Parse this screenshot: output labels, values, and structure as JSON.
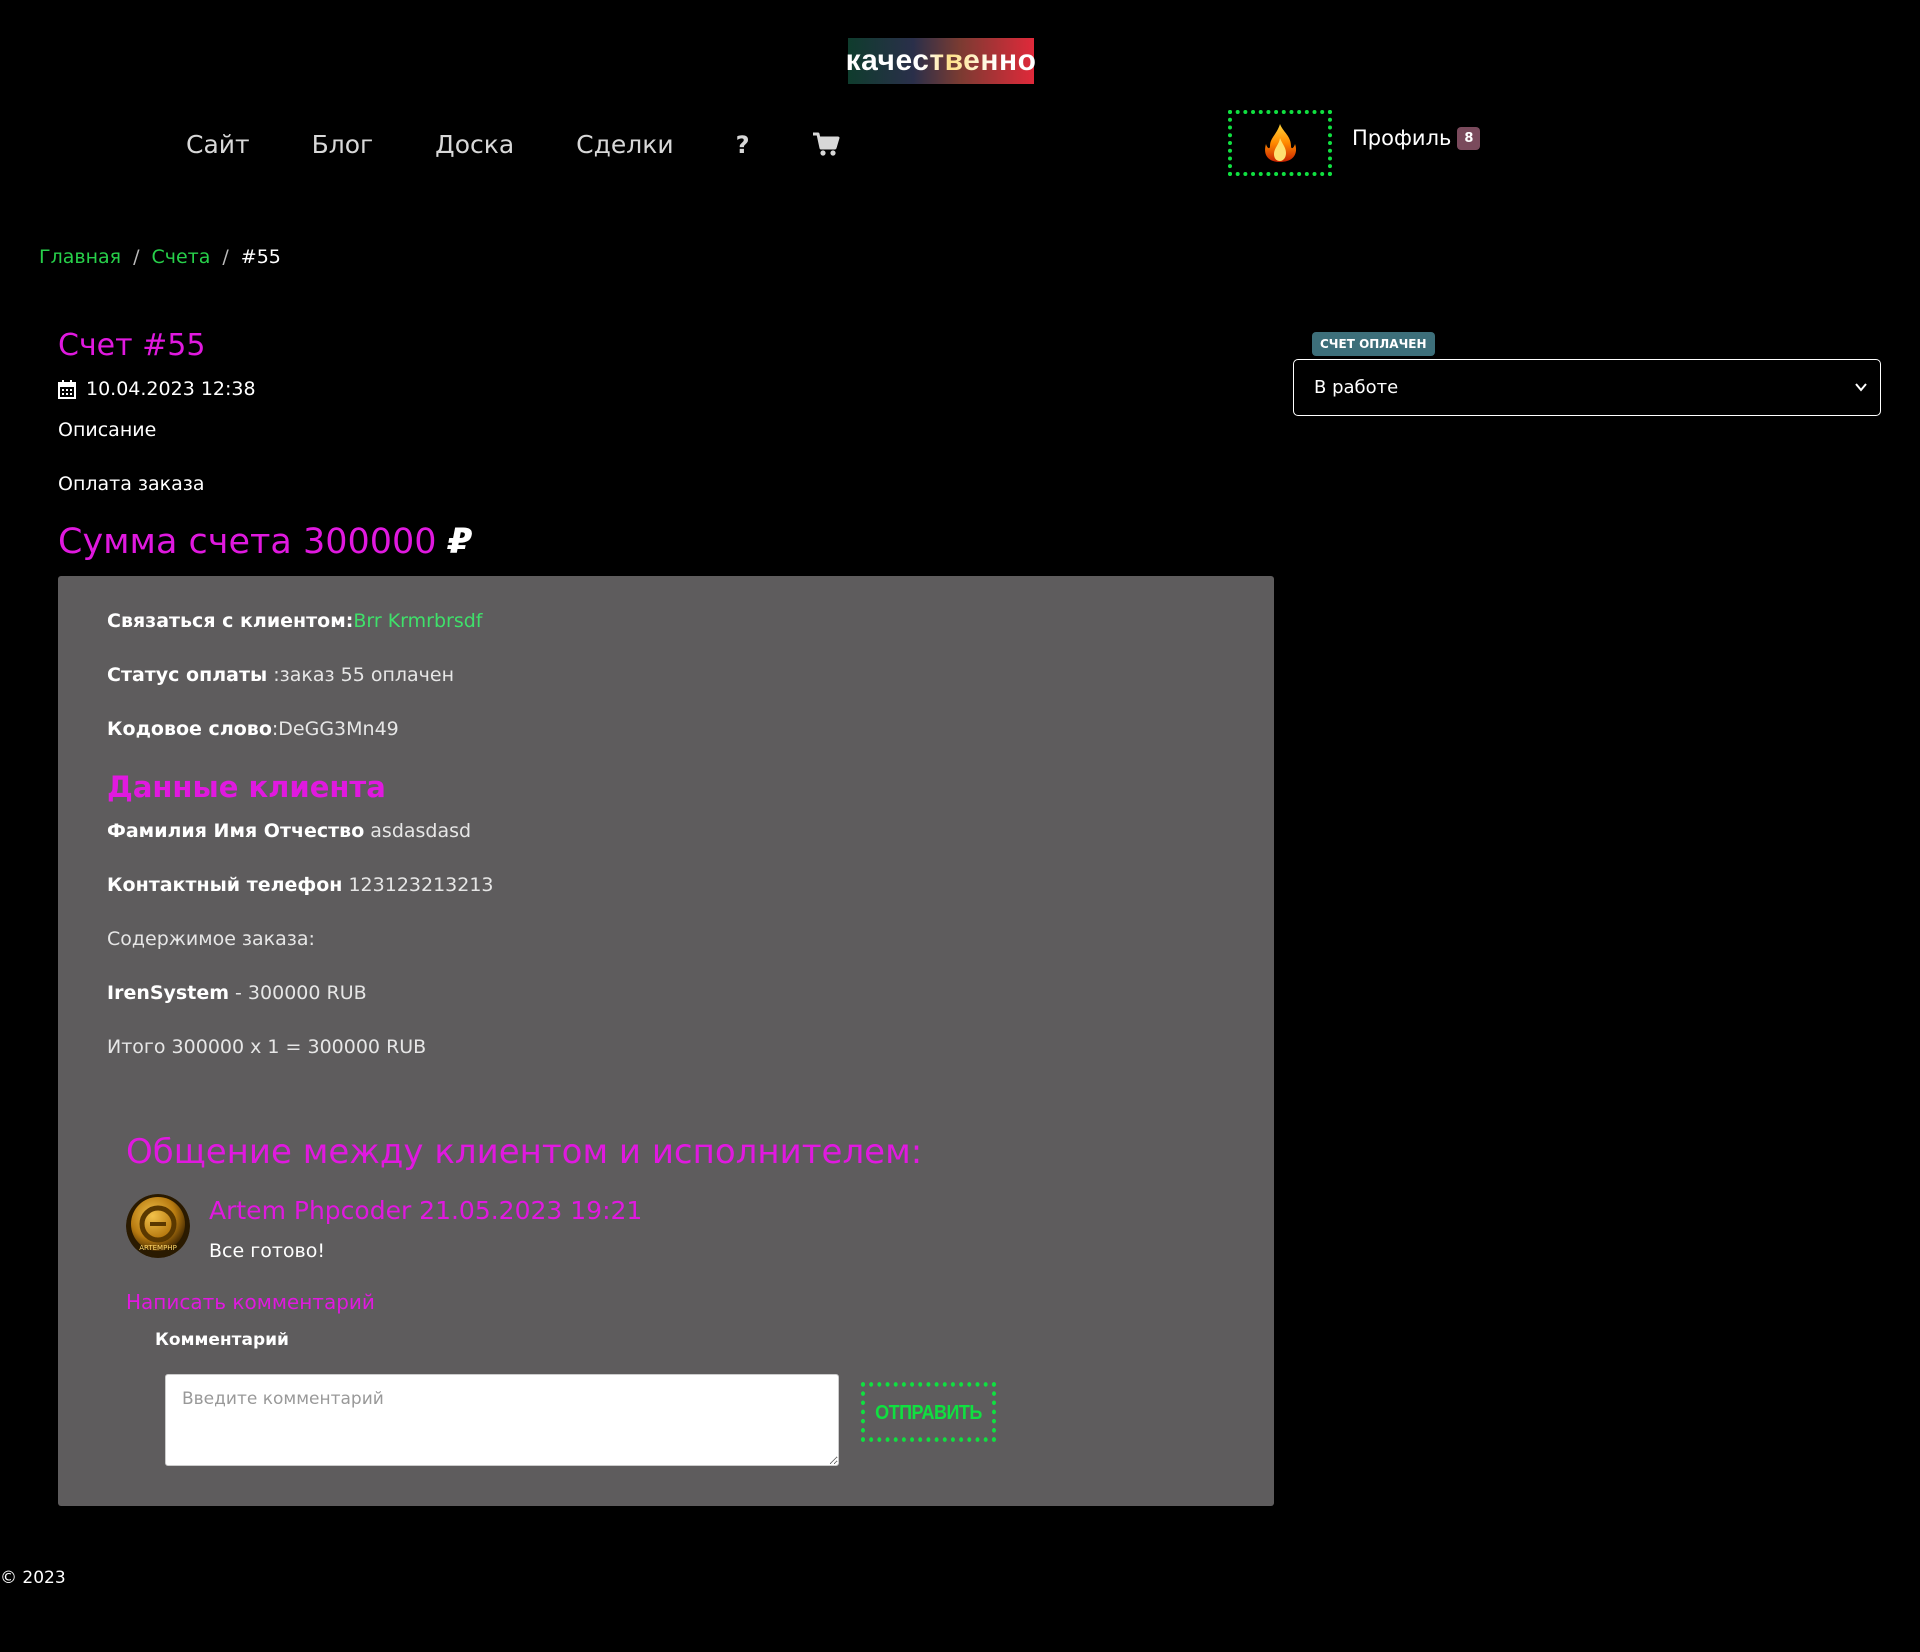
{
  "logo": {
    "text": "качественно"
  },
  "nav": {
    "items": [
      {
        "label": "Сайт"
      },
      {
        "label": "Блог"
      },
      {
        "label": "Доска"
      },
      {
        "label": "Сделки"
      },
      {
        "label": "?"
      }
    ],
    "cart_icon": "cart-icon",
    "fire_icon": "fire-icon",
    "profile_label": "Профиль",
    "profile_badge": "8"
  },
  "breadcrumb": {
    "items": [
      "Главная",
      "Счета"
    ],
    "separator": "/",
    "current": "#55"
  },
  "invoice": {
    "title": "Счет #55",
    "date": "10.04.2023 12:38",
    "description_label": "Описание",
    "description_text": "Оплата заказа",
    "sum_label": "Сумма счета 300000",
    "currency": "₽"
  },
  "details": {
    "contact_label": "Связаться с клиентом:",
    "contact_name": "Brr Krmrbrsdf",
    "payment_status_label": "Статус оплаты",
    "payment_status_value": " :заказ 55 оплачен",
    "code_word_label": "Кодовое слово",
    "code_word_value": ":DeGG3Mn49",
    "client_section_title": "Данные клиента",
    "full_name_label": "Фамилия Имя Отчество",
    "full_name_value": " asdasdasd",
    "phone_label": "Контактный телефон",
    "phone_value": " 123123213213",
    "order_contents_label": "Содержимое заказа:",
    "item_name": "IrenSystem",
    "item_price": " - 300000 RUB",
    "total": "Итого 300000 x 1 = 300000 RUB"
  },
  "chat": {
    "title": "Общение между клиентом и исполнителем:",
    "message_author": "Artem Phpcoder 21.05.2023 19:21",
    "message_text": "Все готово!",
    "avatar_text": "ARTEMPHP",
    "write_comment": "Написать комментарий",
    "comment_label": "Комментарий",
    "comment_placeholder": "Введите комментарий",
    "send_label": "ОТПРАВИТЬ"
  },
  "status": {
    "badge": "Счет оплачен",
    "selected": "В работе"
  },
  "footer": {
    "text": "© 2023"
  },
  "colors": {
    "accent_magenta": "#e019df",
    "accent_green": "#10e040",
    "link_green": "#27d04a",
    "card_bg": "#5e5c5d"
  }
}
